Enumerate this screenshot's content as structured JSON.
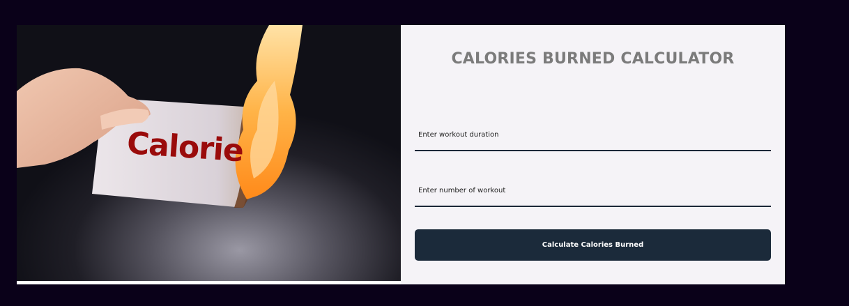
{
  "calculator": {
    "title": "CALORIES BURNED CALCULATOR",
    "duration_placeholder": "Enter workout duration",
    "count_placeholder": "Enter number of workout",
    "submit_label": "Calculate Calories Burned"
  },
  "hero_image": {
    "paper_text": "Calorie"
  },
  "colors": {
    "page_background": "#0a0119",
    "form_background": "#f5f3f7",
    "button_background": "#1b2a3a",
    "title_text": "#7b7b7b",
    "input_underline": "#1b2838"
  }
}
